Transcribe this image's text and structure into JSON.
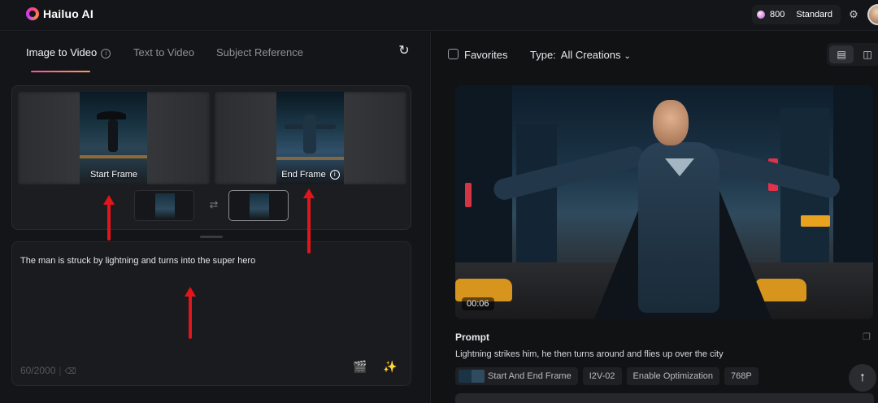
{
  "header": {
    "app_name": "Hailuo AI",
    "credits": "800",
    "plan": "Standard"
  },
  "left": {
    "tabs": [
      {
        "label": "Image to Video",
        "active": true
      },
      {
        "label": "Text to Video",
        "active": false
      },
      {
        "label": "Subject Reference",
        "active": false
      }
    ],
    "info_glyph": "i",
    "start_frame_label": "Start Frame",
    "end_frame_label": "End Frame",
    "prompt_text": "The man is struck by lightning and turns into the super hero",
    "char_count": "60/2000"
  },
  "right": {
    "favorites_label": "Favorites",
    "type_label": "Type:",
    "type_value": "All Creations",
    "video_duration": "00:06",
    "prompt_label": "Prompt",
    "prompt_value": "Lightning strikes him, he then turns around and flies up over the city",
    "tags": [
      "Start And End Frame",
      "I2V-02",
      "Enable Optimization",
      "768P"
    ]
  },
  "colors": {
    "accent_gradient_start": "#ff4f9a",
    "accent_gradient_end": "#ff9a5a",
    "annotation_arrow": "#e0161b",
    "background": "#111214",
    "panel": "#141518"
  }
}
